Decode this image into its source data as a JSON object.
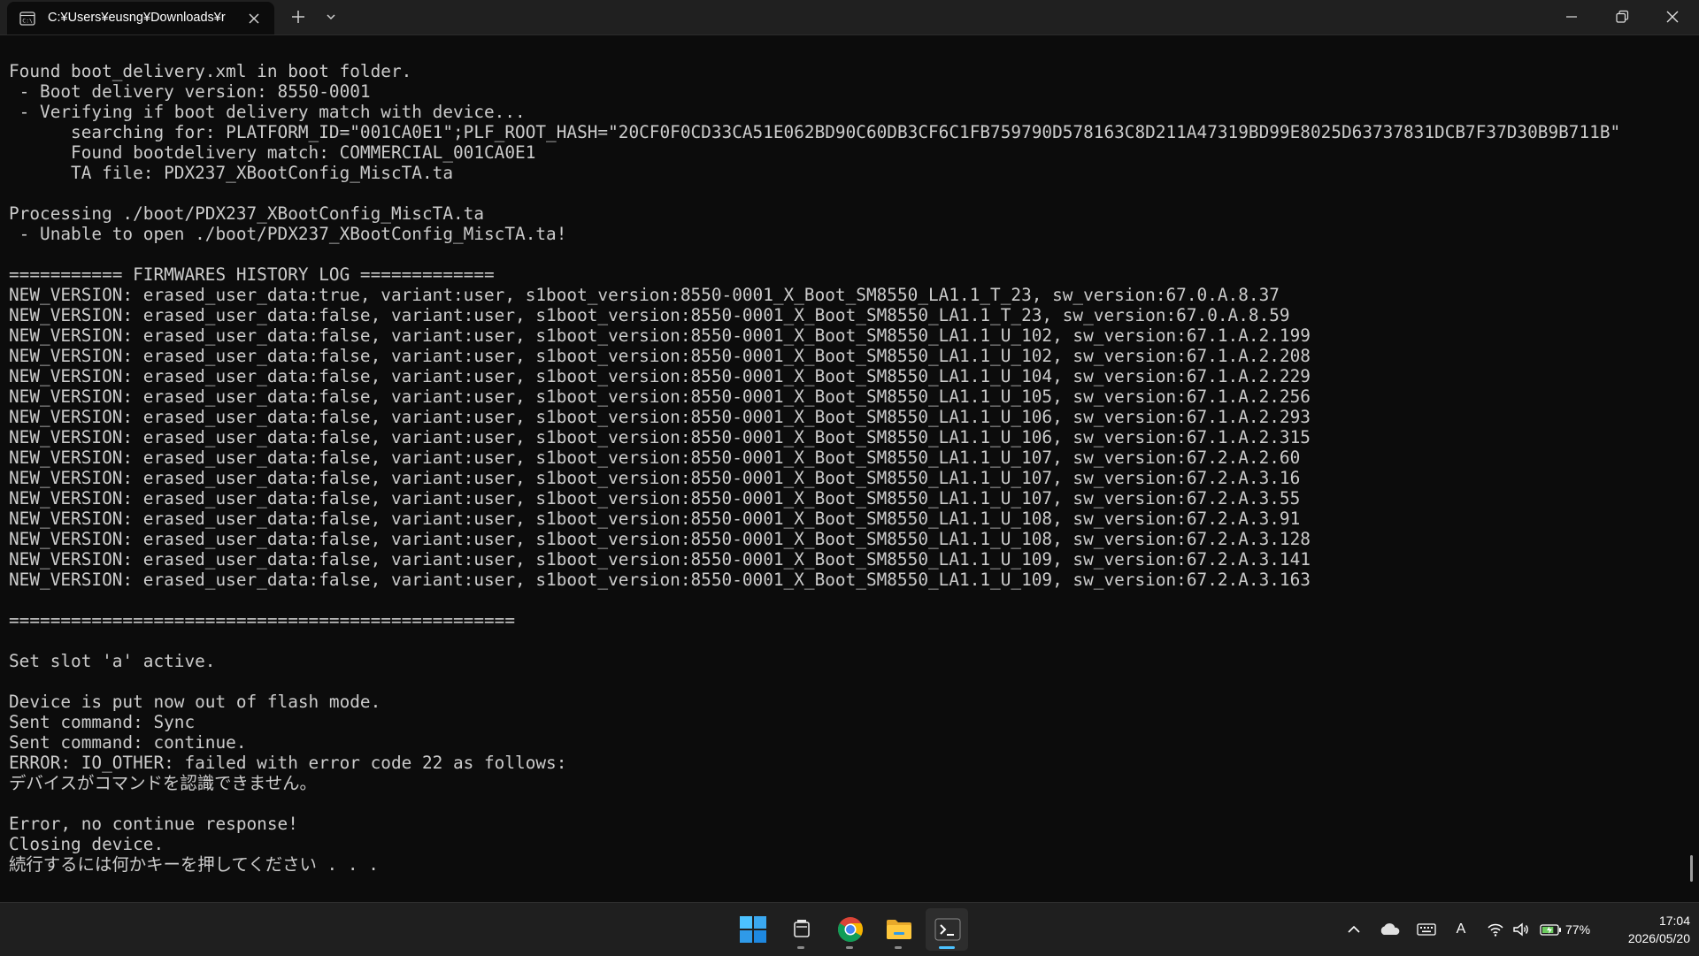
{
  "window": {
    "tab_title": "C:¥Users¥eusng¥Downloads¥r",
    "tab_icon": "console-icon",
    "controls": {
      "minimize_icon": "minimize-icon",
      "restore_icon": "restore-icon",
      "close_icon": "close-icon"
    }
  },
  "terminal": {
    "foreground_color": "#cccccc",
    "background_color": "#0c0c0c",
    "lines": [
      "Found boot_delivery.xml in boot folder.",
      " - Boot delivery version: 8550-0001",
      " - Verifying if boot delivery match with device...",
      "      searching for: PLATFORM_ID=\"001CA0E1\";PLF_ROOT_HASH=\"20CF0F0CD33CA51E062BD90C60DB3CF6C1FB759790D578163C8D211A47319BD99E8025D63737831DCB7F37D30B9B711B\"",
      "      Found bootdelivery match: COMMERCIAL_001CA0E1",
      "      TA file: PDX237_XBootConfig_MiscTA.ta",
      "",
      "Processing ./boot/PDX237_XBootConfig_MiscTA.ta",
      " - Unable to open ./boot/PDX237_XBootConfig_MiscTA.ta!",
      "",
      "=========== FIRMWARES HISTORY LOG =============",
      "NEW_VERSION: erased_user_data:true, variant:user, s1boot_version:8550-0001_X_Boot_SM8550_LA1.1_T_23, sw_version:67.0.A.8.37",
      "NEW_VERSION: erased_user_data:false, variant:user, s1boot_version:8550-0001_X_Boot_SM8550_LA1.1_T_23, sw_version:67.0.A.8.59",
      "NEW_VERSION: erased_user_data:false, variant:user, s1boot_version:8550-0001_X_Boot_SM8550_LA1.1_U_102, sw_version:67.1.A.2.199",
      "NEW_VERSION: erased_user_data:false, variant:user, s1boot_version:8550-0001_X_Boot_SM8550_LA1.1_U_102, sw_version:67.1.A.2.208",
      "NEW_VERSION: erased_user_data:false, variant:user, s1boot_version:8550-0001_X_Boot_SM8550_LA1.1_U_104, sw_version:67.1.A.2.229",
      "NEW_VERSION: erased_user_data:false, variant:user, s1boot_version:8550-0001_X_Boot_SM8550_LA1.1_U_105, sw_version:67.1.A.2.256",
      "NEW_VERSION: erased_user_data:false, variant:user, s1boot_version:8550-0001_X_Boot_SM8550_LA1.1_U_106, sw_version:67.1.A.2.293",
      "NEW_VERSION: erased_user_data:false, variant:user, s1boot_version:8550-0001_X_Boot_SM8550_LA1.1_U_106, sw_version:67.1.A.2.315",
      "NEW_VERSION: erased_user_data:false, variant:user, s1boot_version:8550-0001_X_Boot_SM8550_LA1.1_U_107, sw_version:67.2.A.2.60",
      "NEW_VERSION: erased_user_data:false, variant:user, s1boot_version:8550-0001_X_Boot_SM8550_LA1.1_U_107, sw_version:67.2.A.3.16",
      "NEW_VERSION: erased_user_data:false, variant:user, s1boot_version:8550-0001_X_Boot_SM8550_LA1.1_U_107, sw_version:67.2.A.3.55",
      "NEW_VERSION: erased_user_data:false, variant:user, s1boot_version:8550-0001_X_Boot_SM8550_LA1.1_U_108, sw_version:67.2.A.3.91",
      "NEW_VERSION: erased_user_data:false, variant:user, s1boot_version:8550-0001_X_Boot_SM8550_LA1.1_U_108, sw_version:67.2.A.3.128",
      "NEW_VERSION: erased_user_data:false, variant:user, s1boot_version:8550-0001_X_Boot_SM8550_LA1.1_U_109, sw_version:67.2.A.3.141",
      "NEW_VERSION: erased_user_data:false, variant:user, s1boot_version:8550-0001_X_Boot_SM8550_LA1.1_U_109, sw_version:67.2.A.3.163",
      "",
      "=================================================",
      "",
      "Set slot 'a' active.",
      "",
      "Device is put now out of flash mode.",
      "Sent command: Sync",
      "Sent command: continue.",
      "ERROR: IO_OTHER: failed with error code 22 as follows:",
      "デバイスがコマンドを認識できません。",
      "",
      "Error, no continue response!",
      "Closing device.",
      "続行するには何かキーを押してください . . ."
    ]
  },
  "taskbar": {
    "apps": [
      {
        "name": "Start",
        "icon": "windows-logo-icon"
      },
      {
        "name": "Task View",
        "icon": "task-view-icon"
      },
      {
        "name": "Google Chrome",
        "icon": "chrome-icon"
      },
      {
        "name": "File Explorer",
        "icon": "folder-icon"
      },
      {
        "name": "Terminal",
        "icon": "terminal-icon"
      }
    ],
    "tray": {
      "icons": [
        "chevron-up-icon",
        "onedrive-cloud-icon",
        "keyboard-icon",
        "wifi-icon",
        "volume-icon",
        "battery-icon"
      ],
      "ime_label": "A",
      "battery_percent": "77%"
    },
    "clock": {
      "time": "17:04",
      "date": "2026/05/20"
    },
    "accent_color": "#4cc2ff"
  }
}
